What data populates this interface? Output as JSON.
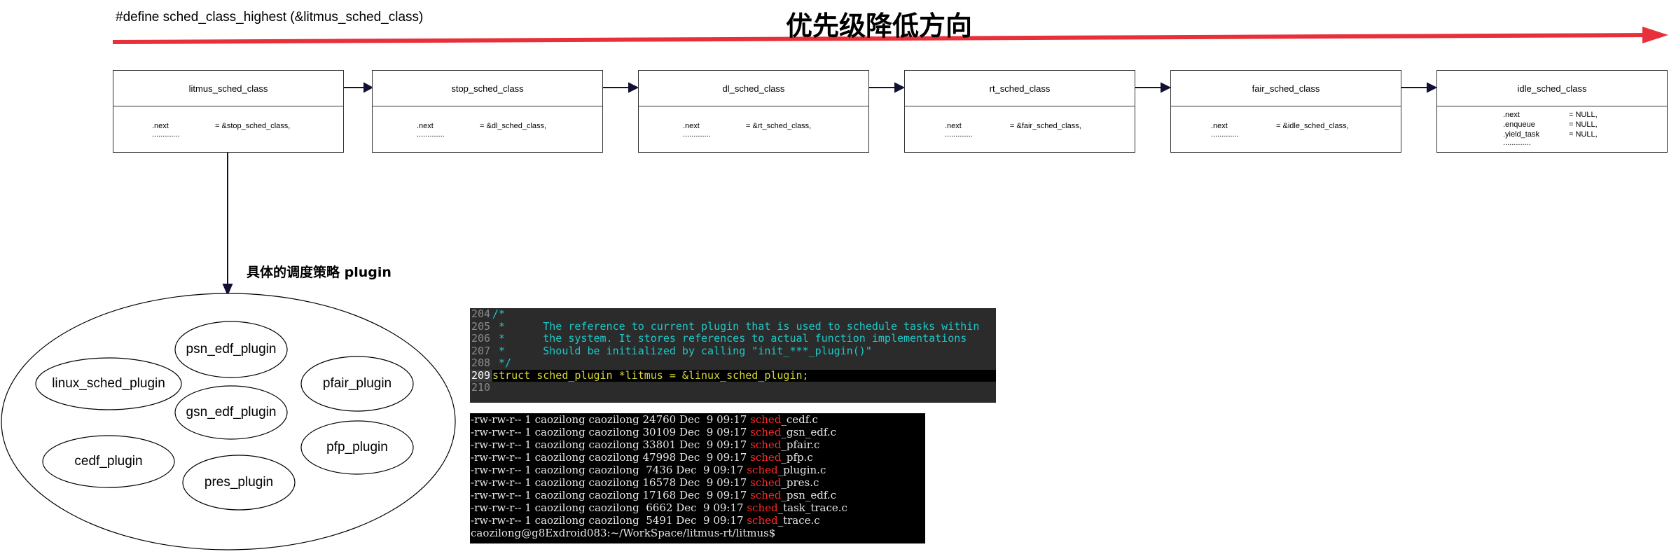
{
  "header": {
    "define_text": "#define sched_class_highest (&litmus_sched_class)",
    "direction_title": "优先级降低方向",
    "arrow_color": "#e8303a"
  },
  "classes": [
    {
      "name": "litmus_sched_class",
      "fields": [
        [
          ".next",
          "= &stop_sched_class,"
        ],
        [
          ".............",
          ""
        ]
      ]
    },
    {
      "name": "stop_sched_class",
      "fields": [
        [
          ".next",
          "= &dl_sched_class,"
        ],
        [
          ".............",
          ""
        ]
      ]
    },
    {
      "name": "dl_sched_class",
      "fields": [
        [
          ".next",
          "= &rt_sched_class,"
        ],
        [
          ".............",
          ""
        ]
      ]
    },
    {
      "name": "rt_sched_class",
      "fields": [
        [
          ".next",
          "= &fair_sched_class,"
        ],
        [
          ".............",
          ""
        ]
      ]
    },
    {
      "name": "fair_sched_class",
      "fields": [
        [
          ".next",
          "= &idle_sched_class,"
        ],
        [
          ".............",
          ""
        ]
      ]
    },
    {
      "name": "idle_sched_class",
      "fields": [
        [
          ".next",
          "= NULL,"
        ],
        [
          ".enqueue",
          "= NULL,"
        ],
        [
          ".yield_task",
          "= NULL,"
        ],
        [
          ".............",
          ""
        ]
      ]
    }
  ],
  "plugin_label": "具体的调度策略 plugin",
  "plugins": [
    "psn_edf_plugin",
    "linux_sched_plugin",
    "pfair_plugin",
    "gsn_edf_plugin",
    "pfp_plugin",
    "cedf_plugin",
    "pres_plugin"
  ],
  "code": {
    "lines": [
      {
        "num": "204",
        "text": "/*",
        "type": "comment"
      },
      {
        "num": "205",
        "text": " *      The reference to current plugin that is used to schedule tasks within",
        "type": "comment"
      },
      {
        "num": "206",
        "text": " *      the system. It stores references to actual function implementations",
        "type": "comment"
      },
      {
        "num": "207",
        "text": " *      Should be initialized by calling \"init_***_plugin()\"",
        "type": "comment"
      },
      {
        "num": "208",
        "text": " */",
        "type": "comment"
      },
      {
        "num": "209",
        "text": "struct sched_plugin *litmus = &linux_sched_plugin;",
        "type": "code"
      },
      {
        "num": "210",
        "text": "",
        "type": "code"
      }
    ]
  },
  "terminal": {
    "files": [
      {
        "perm": "-rw-rw-r--",
        "links": "1",
        "owner": "caozilong",
        "group": "caozilong",
        "size": "24760",
        "month": "Dec",
        "day": "9",
        "time": "09:17",
        "prefix": "sched",
        "suffix": "_cedf.c"
      },
      {
        "perm": "-rw-rw-r--",
        "links": "1",
        "owner": "caozilong",
        "group": "caozilong",
        "size": "30109",
        "month": "Dec",
        "day": "9",
        "time": "09:17",
        "prefix": "sched",
        "suffix": "_gsn_edf.c"
      },
      {
        "perm": "-rw-rw-r--",
        "links": "1",
        "owner": "caozilong",
        "group": "caozilong",
        "size": "33801",
        "month": "Dec",
        "day": "9",
        "time": "09:17",
        "prefix": "sched",
        "suffix": "_pfair.c"
      },
      {
        "perm": "-rw-rw-r--",
        "links": "1",
        "owner": "caozilong",
        "group": "caozilong",
        "size": "47998",
        "month": "Dec",
        "day": "9",
        "time": "09:17",
        "prefix": "sched",
        "suffix": "_pfp.c"
      },
      {
        "perm": "-rw-rw-r--",
        "links": "1",
        "owner": "caozilong",
        "group": "caozilong",
        "size": " 7436",
        "month": "Dec",
        "day": "9",
        "time": "09:17",
        "prefix": "sched",
        "suffix": "_plugin.c"
      },
      {
        "perm": "-rw-rw-r--",
        "links": "1",
        "owner": "caozilong",
        "group": "caozilong",
        "size": "16578",
        "month": "Dec",
        "day": "9",
        "time": "09:17",
        "prefix": "sched",
        "suffix": "_pres.c"
      },
      {
        "perm": "-rw-rw-r--",
        "links": "1",
        "owner": "caozilong",
        "group": "caozilong",
        "size": "17168",
        "month": "Dec",
        "day": "9",
        "time": "09:17",
        "prefix": "sched",
        "suffix": "_psn_edf.c"
      },
      {
        "perm": "-rw-rw-r--",
        "links": "1",
        "owner": "caozilong",
        "group": "caozilong",
        "size": " 6662",
        "month": "Dec",
        "day": "9",
        "time": "09:17",
        "prefix": "sched",
        "suffix": "_task_trace.c"
      },
      {
        "perm": "-rw-rw-r--",
        "links": "1",
        "owner": "caozilong",
        "group": "caozilong",
        "size": " 5491",
        "month": "Dec",
        "day": "9",
        "time": "09:17",
        "prefix": "sched",
        "suffix": "_trace.c"
      }
    ],
    "prompt": "caozilong@g8Exdroid083:~/WorkSpace/litmus-rt/litmus$"
  }
}
